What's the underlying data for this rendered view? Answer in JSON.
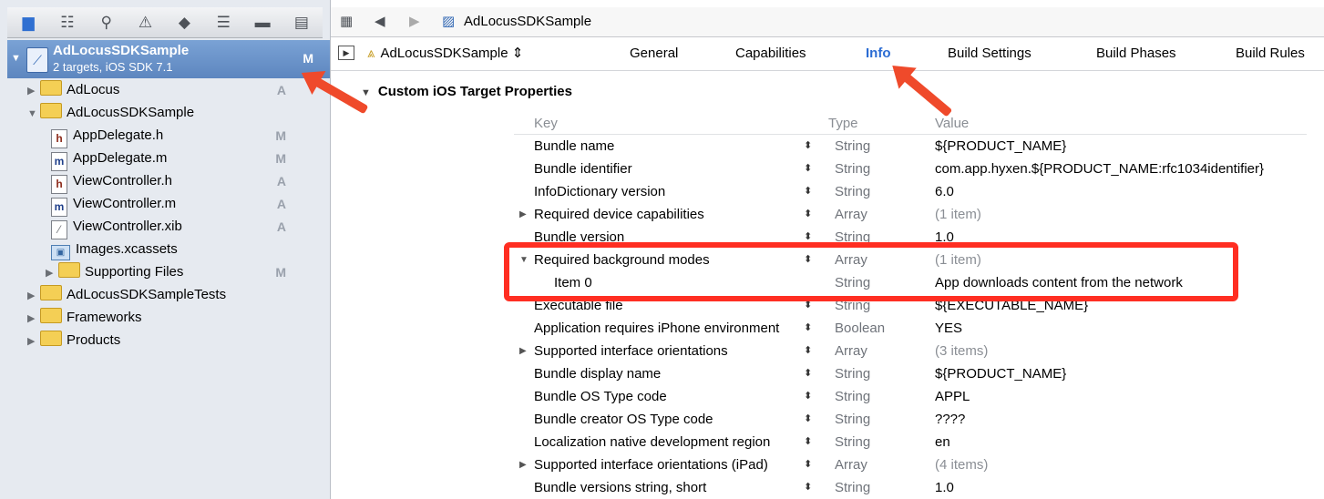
{
  "navigator": {
    "toolbar_icons": [
      "folder-icon",
      "hierarchy-icon",
      "search-icon",
      "warning-icon",
      "test-diamond-icon",
      "debug-icon",
      "breakpoint-icon",
      "log-icon"
    ],
    "toolbar_glyphs": [
      "▆",
      "☷",
      "⚲",
      "⚠",
      "◆",
      "☰",
      "▬",
      "▤"
    ],
    "project": {
      "name": "AdLocusSDKSample",
      "subtitle": "2 targets, iOS SDK 7.1",
      "badge": "M"
    },
    "items": [
      {
        "label": "AdLocus",
        "badge": "A"
      },
      {
        "label": "AdLocusSDKSample",
        "badge": ""
      },
      {
        "label": "AppDelegate.h",
        "badge": "M",
        "icon": "h"
      },
      {
        "label": "AppDelegate.m",
        "badge": "M",
        "icon": "m"
      },
      {
        "label": "ViewController.h",
        "badge": "A",
        "icon": "h"
      },
      {
        "label": "ViewController.m",
        "badge": "A",
        "icon": "m"
      },
      {
        "label": "ViewController.xib",
        "badge": "A",
        "icon": "⁄"
      },
      {
        "label": "Images.xcassets",
        "badge": "",
        "icon": "▣"
      },
      {
        "label": "Supporting Files",
        "badge": "M"
      },
      {
        "label": "AdLocusSDKSampleTests",
        "badge": ""
      },
      {
        "label": "Frameworks",
        "badge": ""
      },
      {
        "label": "Products",
        "badge": ""
      }
    ]
  },
  "jumpbar": {
    "grid": "▦",
    "back": "◀",
    "forward": "▶",
    "project": "AdLocusSDKSample"
  },
  "tabs": {
    "target": "AdLocusSDKSample",
    "target_chevron": "⇕",
    "items": [
      "General",
      "Capabilities",
      "Info",
      "Build Settings",
      "Build Phases",
      "Build Rules"
    ],
    "active": "Info"
  },
  "section": {
    "title": "Custom iOS Target Properties"
  },
  "columns": {
    "key": "Key",
    "type": "Type",
    "value": "Value"
  },
  "properties": [
    {
      "key": "Bundle name",
      "type": "String",
      "value": "${PRODUCT_NAME}"
    },
    {
      "key": "Bundle identifier",
      "type": "String",
      "value": "com.app.hyxen.${PRODUCT_NAME:rfc1034identifier}"
    },
    {
      "key": "InfoDictionary version",
      "type": "String",
      "value": "6.0"
    },
    {
      "key": "Required device capabilities",
      "type": "Array",
      "value": "(1 item)",
      "collapsed": true
    },
    {
      "key": "Bundle version",
      "type": "String",
      "value": "1.0"
    },
    {
      "key": "Required background modes",
      "type": "Array",
      "value": "(1 item)",
      "expanded": true
    },
    {
      "key": "Item 0",
      "type": "String",
      "value": "App downloads content from the network",
      "child": true
    },
    {
      "key": "Executable file",
      "type": "String",
      "value": "${EXECUTABLE_NAME}"
    },
    {
      "key": "Application requires iPhone environment",
      "type": "Boolean",
      "value": "YES"
    },
    {
      "key": "Supported interface orientations",
      "type": "Array",
      "value": "(3 items)",
      "collapsed": true
    },
    {
      "key": "Bundle display name",
      "type": "String",
      "value": "${PRODUCT_NAME}"
    },
    {
      "key": "Bundle OS Type code",
      "type": "String",
      "value": "APPL"
    },
    {
      "key": "Bundle creator OS Type code",
      "type": "String",
      "value": "????"
    },
    {
      "key": "Localization native development region",
      "type": "String",
      "value": "en"
    },
    {
      "key": "Supported interface orientations (iPad)",
      "type": "Array",
      "value": "(4 items)",
      "collapsed": true
    },
    {
      "key": "Bundle versions string, short",
      "type": "String",
      "value": "1.0"
    }
  ],
  "colors": {
    "accent": "#2b6cd3",
    "annotation": "#ff2e22",
    "project_row": "#6b93c9"
  }
}
